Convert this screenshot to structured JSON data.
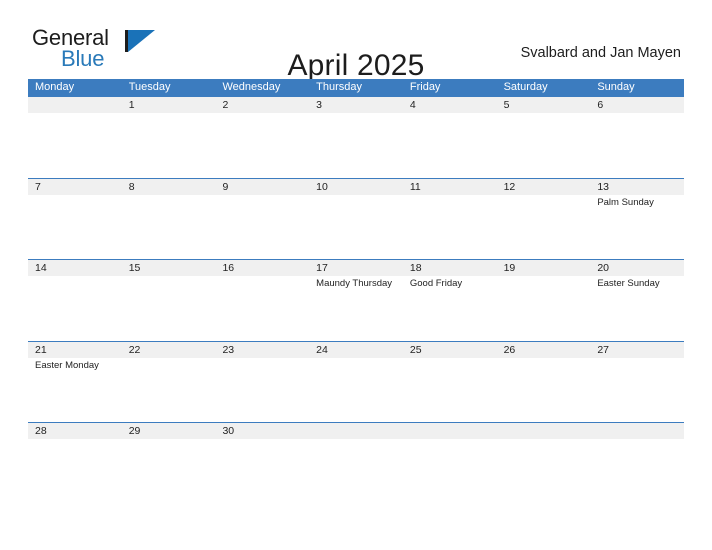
{
  "brand": {
    "name_part1": "General",
    "name_part2": "Blue",
    "triangle_color": "#1a72b8",
    "blue_color": "#2a7ab9"
  },
  "header": {
    "title": "April 2025",
    "region": "Svalbard and Jan Mayen"
  },
  "theme": {
    "header_blue": "#3c7cbf",
    "date_band_gray": "#f0f0f0",
    "text_color": "#222222",
    "page_background": "#ffffff"
  },
  "calendar": {
    "weekdays": [
      "Monday",
      "Tuesday",
      "Wednesday",
      "Thursday",
      "Friday",
      "Saturday",
      "Sunday"
    ],
    "weeks": [
      [
        {
          "day": "",
          "event": ""
        },
        {
          "day": "1",
          "event": ""
        },
        {
          "day": "2",
          "event": ""
        },
        {
          "day": "3",
          "event": ""
        },
        {
          "day": "4",
          "event": ""
        },
        {
          "day": "5",
          "event": ""
        },
        {
          "day": "6",
          "event": ""
        }
      ],
      [
        {
          "day": "7",
          "event": ""
        },
        {
          "day": "8",
          "event": ""
        },
        {
          "day": "9",
          "event": ""
        },
        {
          "day": "10",
          "event": ""
        },
        {
          "day": "11",
          "event": ""
        },
        {
          "day": "12",
          "event": ""
        },
        {
          "day": "13",
          "event": "Palm Sunday"
        }
      ],
      [
        {
          "day": "14",
          "event": ""
        },
        {
          "day": "15",
          "event": ""
        },
        {
          "day": "16",
          "event": ""
        },
        {
          "day": "17",
          "event": "Maundy Thursday"
        },
        {
          "day": "18",
          "event": "Good Friday"
        },
        {
          "day": "19",
          "event": ""
        },
        {
          "day": "20",
          "event": "Easter Sunday"
        }
      ],
      [
        {
          "day": "21",
          "event": "Easter Monday"
        },
        {
          "day": "22",
          "event": ""
        },
        {
          "day": "23",
          "event": ""
        },
        {
          "day": "24",
          "event": ""
        },
        {
          "day": "25",
          "event": ""
        },
        {
          "day": "26",
          "event": ""
        },
        {
          "day": "27",
          "event": ""
        }
      ],
      [
        {
          "day": "28",
          "event": ""
        },
        {
          "day": "29",
          "event": ""
        },
        {
          "day": "30",
          "event": ""
        },
        {
          "day": "",
          "event": ""
        },
        {
          "day": "",
          "event": ""
        },
        {
          "day": "",
          "event": ""
        },
        {
          "day": "",
          "event": ""
        }
      ]
    ]
  }
}
